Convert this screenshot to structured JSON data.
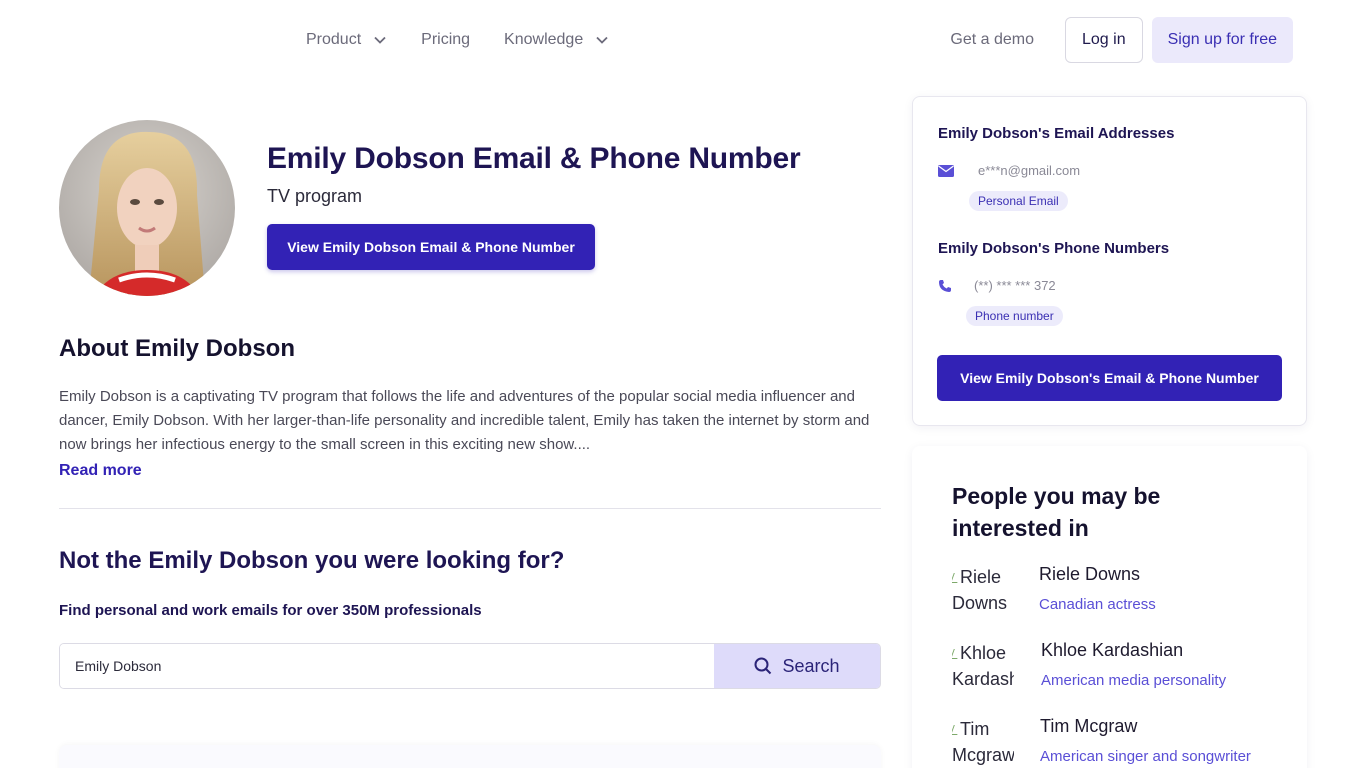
{
  "nav": {
    "items": [
      {
        "label": "Product",
        "has_dropdown": true
      },
      {
        "label": "Pricing",
        "has_dropdown": false
      },
      {
        "label": "Knowledge",
        "has_dropdown": true
      }
    ],
    "demo_label": "Get a demo",
    "login_label": "Log in",
    "signup_label": "Sign up for free"
  },
  "profile": {
    "title": "Emily Dobson Email & Phone Number",
    "subtitle": "TV program",
    "cta_label": "View Emily Dobson Email & Phone Number"
  },
  "about": {
    "title": "About Emily Dobson",
    "text": "Emily Dobson is a captivating TV program that follows the life and adventures of the popular social media influencer and dancer, Emily Dobson. With her larger-than-life personality and incredible talent, Emily has taken the internet by storm and now brings her infectious energy to the small screen in this exciting new show....",
    "read_more": "Read more"
  },
  "not_the_one": {
    "title": "Not the Emily Dobson you were looking for?",
    "subtitle": "Find personal and work emails for over 350M professionals",
    "search_value": "Emily Dobson",
    "search_button": "Search"
  },
  "contact_card": {
    "email_heading": "Emily Dobson's Email Addresses",
    "email_value": "e***n@gmail.com",
    "email_tag": "Personal Email",
    "phone_heading": "Emily Dobson's Phone Numbers",
    "phone_value": "(**) *** *** 372",
    "phone_tag": "Phone number",
    "cta_label": "View Emily Dobson's Email & Phone Number"
  },
  "people": {
    "title": "People you may be interested in",
    "items": [
      {
        "img_alt": "Riele Downs",
        "name": "Riele Downs",
        "desc": "Canadian actress"
      },
      {
        "img_alt": "Khloe Kardashian",
        "name": "Khloe Kardashian",
        "desc": "American media personality"
      },
      {
        "img_alt": "Tim Mcgraw",
        "name": "Tim Mcgraw",
        "desc": "American singer and songwriter"
      }
    ]
  },
  "colors": {
    "primary": "#3222b5",
    "heading": "#1e1553",
    "accent_light": "#ecebfb",
    "link_secondary": "#5a4fd6"
  }
}
